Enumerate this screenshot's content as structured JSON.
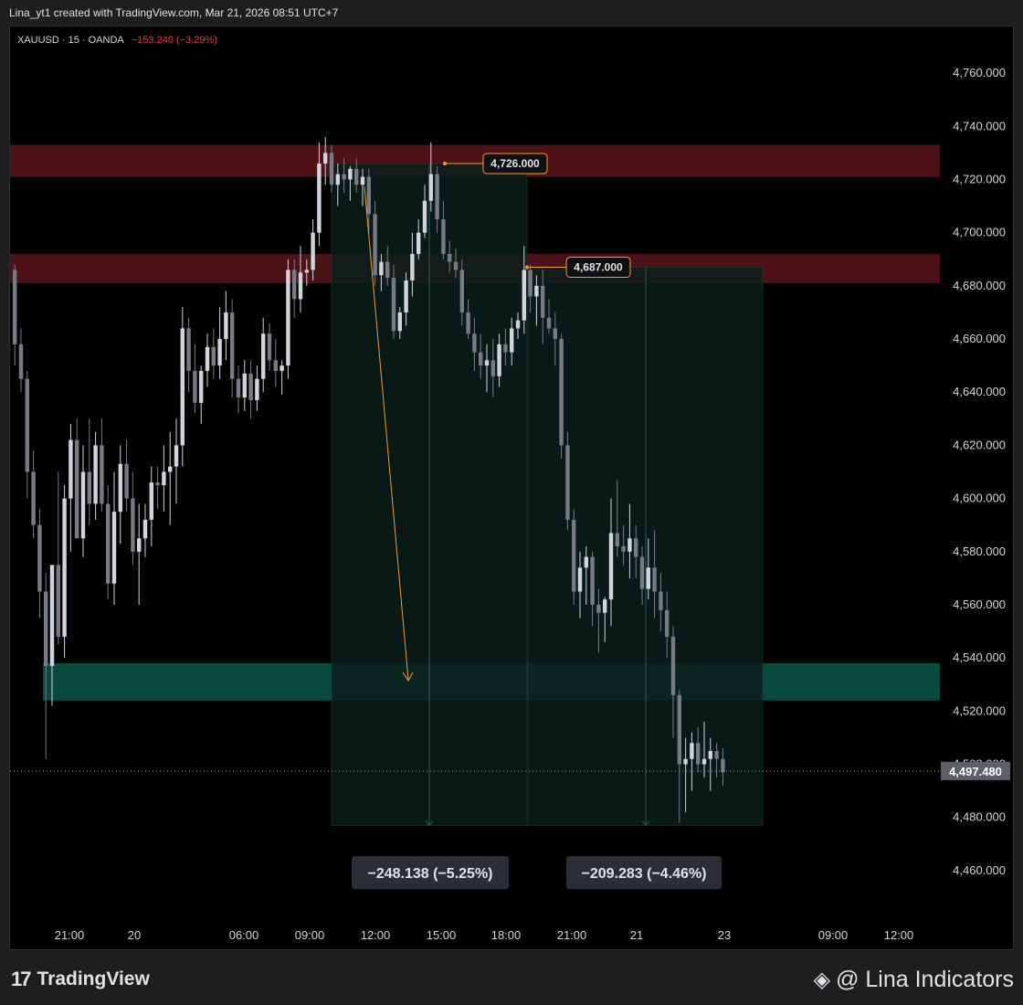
{
  "header": {
    "caption": "Lina_yt1 created with TradingView.com, Mar 21, 2026 08:51 UTC+7"
  },
  "symbol": {
    "info": "XAUUSD · 15 · OANDA",
    "change": "−153.240 (−3.29%)",
    "change_color": "#f23645"
  },
  "footer": {
    "logo_mark": "17",
    "logo_text": "TradingView",
    "brand_icon": "binance-diamond-icon",
    "brand_text": "@ Lina Indicators"
  },
  "colors": {
    "up": "#d1d4dc",
    "down": "#787b86",
    "resistance_zone": "#5a141c",
    "support_zone": "#0a5245",
    "measure_fill": "#0b1e1b",
    "arrow": "#f0a030",
    "last_price_bg": "#5d606b"
  },
  "chart_data": {
    "type": "candlestick",
    "symbol": "XAUUSD",
    "timeframe": "15",
    "ylim": [
      4450,
      4770
    ],
    "y_ticks": [
      4460,
      4480,
      4500,
      4520,
      4540,
      4560,
      4580,
      4600,
      4620,
      4640,
      4660,
      4680,
      4700,
      4720,
      4740,
      4760
    ],
    "y_tick_labels": [
      "4,460.000",
      "4,480.000",
      "4,500.000",
      "4,520.000",
      "4,540.000",
      "4,560.000",
      "4,580.000",
      "4,600.000",
      "4,620.000",
      "4,640.000",
      "4,660.000",
      "4,680.000",
      "4,700.000",
      "4,720.000",
      "4,740.000",
      "4,760.000"
    ],
    "x_tick_labels": [
      "21:00",
      "20",
      "06:00",
      "09:00",
      "12:00",
      "15:00",
      "18:00",
      "21:00",
      "21",
      "23",
      "09:00",
      "12:00"
    ],
    "last_price": 4497.48,
    "last_price_label": "4,497.480",
    "zones": [
      {
        "kind": "resistance",
        "from": 4721,
        "to": 4733
      },
      {
        "kind": "resistance",
        "from": 4681,
        "to": 4692
      },
      {
        "kind": "support",
        "from": 4524,
        "to": 4538
      }
    ],
    "price_labels": [
      {
        "value": 4726,
        "text": "4,726.000"
      },
      {
        "value": 4687,
        "text": "4,687.000"
      }
    ],
    "measurements": [
      {
        "from": 4726,
        "to": 4477,
        "text": "−248.138 (−5.25%)"
      },
      {
        "from": 4687,
        "to": 4477,
        "text": "−209.283 (−4.46%)"
      }
    ],
    "candles": [
      [
        4686,
        4688,
        4650,
        4658
      ],
      [
        4658,
        4664,
        4640,
        4645
      ],
      [
        4645,
        4648,
        4600,
        4610
      ],
      [
        4610,
        4618,
        4585,
        4590
      ],
      [
        4590,
        4596,
        4555,
        4565
      ],
      [
        4565,
        4572,
        4502,
        4537
      ],
      [
        4537,
        4542,
        4522,
        4575
      ],
      [
        4575,
        4610,
        4545,
        4548
      ],
      [
        4548,
        4605,
        4540,
        4600
      ],
      [
        4600,
        4628,
        4580,
        4622
      ],
      [
        4622,
        4630,
        4600,
        4585
      ],
      [
        4585,
        4620,
        4578,
        4610
      ],
      [
        4610,
        4630,
        4590,
        4598
      ],
      [
        4598,
        4625,
        4592,
        4620
      ],
      [
        4620,
        4630,
        4595,
        4598
      ],
      [
        4598,
        4605,
        4562,
        4568
      ],
      [
        4568,
        4610,
        4560,
        4595
      ],
      [
        4595,
        4620,
        4583,
        4613
      ],
      [
        4613,
        4622,
        4595,
        4600
      ],
      [
        4600,
        4610,
        4575,
        4580
      ],
      [
        4580,
        4598,
        4560,
        4585
      ],
      [
        4585,
        4598,
        4578,
        4592
      ],
      [
        4592,
        4612,
        4582,
        4606
      ],
      [
        4606,
        4612,
        4596,
        4605
      ],
      [
        4605,
        4620,
        4595,
        4610
      ],
      [
        4610,
        4625,
        4590,
        4612
      ],
      [
        4612,
        4630,
        4598,
        4620
      ],
      [
        4620,
        4672,
        4612,
        4664
      ],
      [
        4664,
        4668,
        4640,
        4648
      ],
      [
        4648,
        4658,
        4632,
        4636
      ],
      [
        4636,
        4650,
        4628,
        4648
      ],
      [
        4648,
        4662,
        4642,
        4657
      ],
      [
        4657,
        4664,
        4645,
        4650
      ],
      [
        4650,
        4672,
        4645,
        4660
      ],
      [
        4660,
        4678,
        4652,
        4670
      ],
      [
        4670,
        4675,
        4638,
        4645
      ],
      [
        4645,
        4650,
        4632,
        4638
      ],
      [
        4638,
        4652,
        4633,
        4647
      ],
      [
        4647,
        4652,
        4630,
        4637
      ],
      [
        4637,
        4650,
        4633,
        4645
      ],
      [
        4645,
        4668,
        4640,
        4662
      ],
      [
        4662,
        4666,
        4648,
        4652
      ],
      [
        4652,
        4660,
        4642,
        4648
      ],
      [
        4648,
        4652,
        4639,
        4650
      ],
      [
        4650,
        4690,
        4645,
        4686
      ],
      [
        4686,
        4690,
        4668,
        4675
      ],
      [
        4675,
        4695,
        4670,
        4685
      ],
      [
        4685,
        4690,
        4680,
        4686
      ],
      [
        4686,
        4705,
        4682,
        4700
      ],
      [
        4700,
        4734,
        4695,
        4726
      ],
      [
        4726,
        4736,
        4718,
        4730
      ],
      [
        4730,
        4733,
        4715,
        4718
      ],
      [
        4718,
        4726,
        4710,
        4722
      ],
      [
        4722,
        4728,
        4715,
        4720
      ],
      [
        4720,
        4725,
        4712,
        4724
      ],
      [
        4724,
        4728,
        4715,
        4718
      ],
      [
        4718,
        4724,
        4710,
        4721
      ],
      [
        4721,
        4724,
        4700,
        4707
      ],
      [
        4707,
        4712,
        4680,
        4684
      ],
      [
        4684,
        4692,
        4678,
        4689
      ],
      [
        4689,
        4695,
        4680,
        4683
      ],
      [
        4683,
        4688,
        4660,
        4663
      ],
      [
        4663,
        4672,
        4660,
        4670
      ],
      [
        4670,
        4685,
        4665,
        4682
      ],
      [
        4682,
        4700,
        4676,
        4692
      ],
      [
        4692,
        4705,
        4690,
        4700
      ],
      [
        4700,
        4718,
        4698,
        4712
      ],
      [
        4712,
        4734,
        4708,
        4722
      ],
      [
        4722,
        4725,
        4700,
        4705
      ],
      [
        4705,
        4712,
        4690,
        4692
      ],
      [
        4692,
        4697,
        4685,
        4689
      ],
      [
        4689,
        4694,
        4683,
        4686
      ],
      [
        4686,
        4690,
        4665,
        4670
      ],
      [
        4670,
        4675,
        4660,
        4662
      ],
      [
        4662,
        4668,
        4648,
        4655
      ],
      [
        4655,
        4662,
        4645,
        4650
      ],
      [
        4650,
        4658,
        4640,
        4652
      ],
      [
        4652,
        4660,
        4638,
        4646
      ],
      [
        4646,
        4662,
        4642,
        4658
      ],
      [
        4658,
        4664,
        4650,
        4655
      ],
      [
        4655,
        4668,
        4650,
        4664
      ],
      [
        4664,
        4670,
        4660,
        4667
      ],
      [
        4667,
        4695,
        4662,
        4686
      ],
      [
        4686,
        4688,
        4670,
        4676
      ],
      [
        4676,
        4684,
        4665,
        4680
      ],
      [
        4680,
        4686,
        4658,
        4668
      ],
      [
        4668,
        4675,
        4662,
        4664
      ],
      [
        4664,
        4670,
        4650,
        4660
      ],
      [
        4660,
        4662,
        4615,
        4620
      ],
      [
        4620,
        4625,
        4588,
        4592
      ],
      [
        4592,
        4596,
        4560,
        4565
      ],
      [
        4565,
        4580,
        4555,
        4574
      ],
      [
        4574,
        4582,
        4560,
        4578
      ],
      [
        4578,
        4580,
        4552,
        4560
      ],
      [
        4560,
        4566,
        4542,
        4557
      ],
      [
        4557,
        4563,
        4546,
        4562
      ],
      [
        4562,
        4600,
        4552,
        4587
      ],
      [
        4587,
        4607,
        4578,
        4582
      ],
      [
        4582,
        4590,
        4575,
        4580
      ],
      [
        4580,
        4598,
        4570,
        4585
      ],
      [
        4585,
        4590,
        4570,
        4578
      ],
      [
        4578,
        4582,
        4560,
        4566
      ],
      [
        4566,
        4585,
        4562,
        4574
      ],
      [
        4574,
        4588,
        4555,
        4565
      ],
      [
        4565,
        4572,
        4550,
        4558
      ],
      [
        4558,
        4565,
        4540,
        4548
      ],
      [
        4548,
        4552,
        4510,
        4526
      ],
      [
        4526,
        4528,
        4478,
        4500
      ],
      [
        4500,
        4510,
        4482,
        4502
      ],
      [
        4502,
        4512,
        4490,
        4508
      ],
      [
        4508,
        4514,
        4497,
        4500
      ],
      [
        4500,
        4516,
        4495,
        4502
      ],
      [
        4502,
        4510,
        4490,
        4505
      ],
      [
        4505,
        4508,
        4495,
        4502
      ],
      [
        4502,
        4506,
        4492,
        4497
      ]
    ]
  }
}
